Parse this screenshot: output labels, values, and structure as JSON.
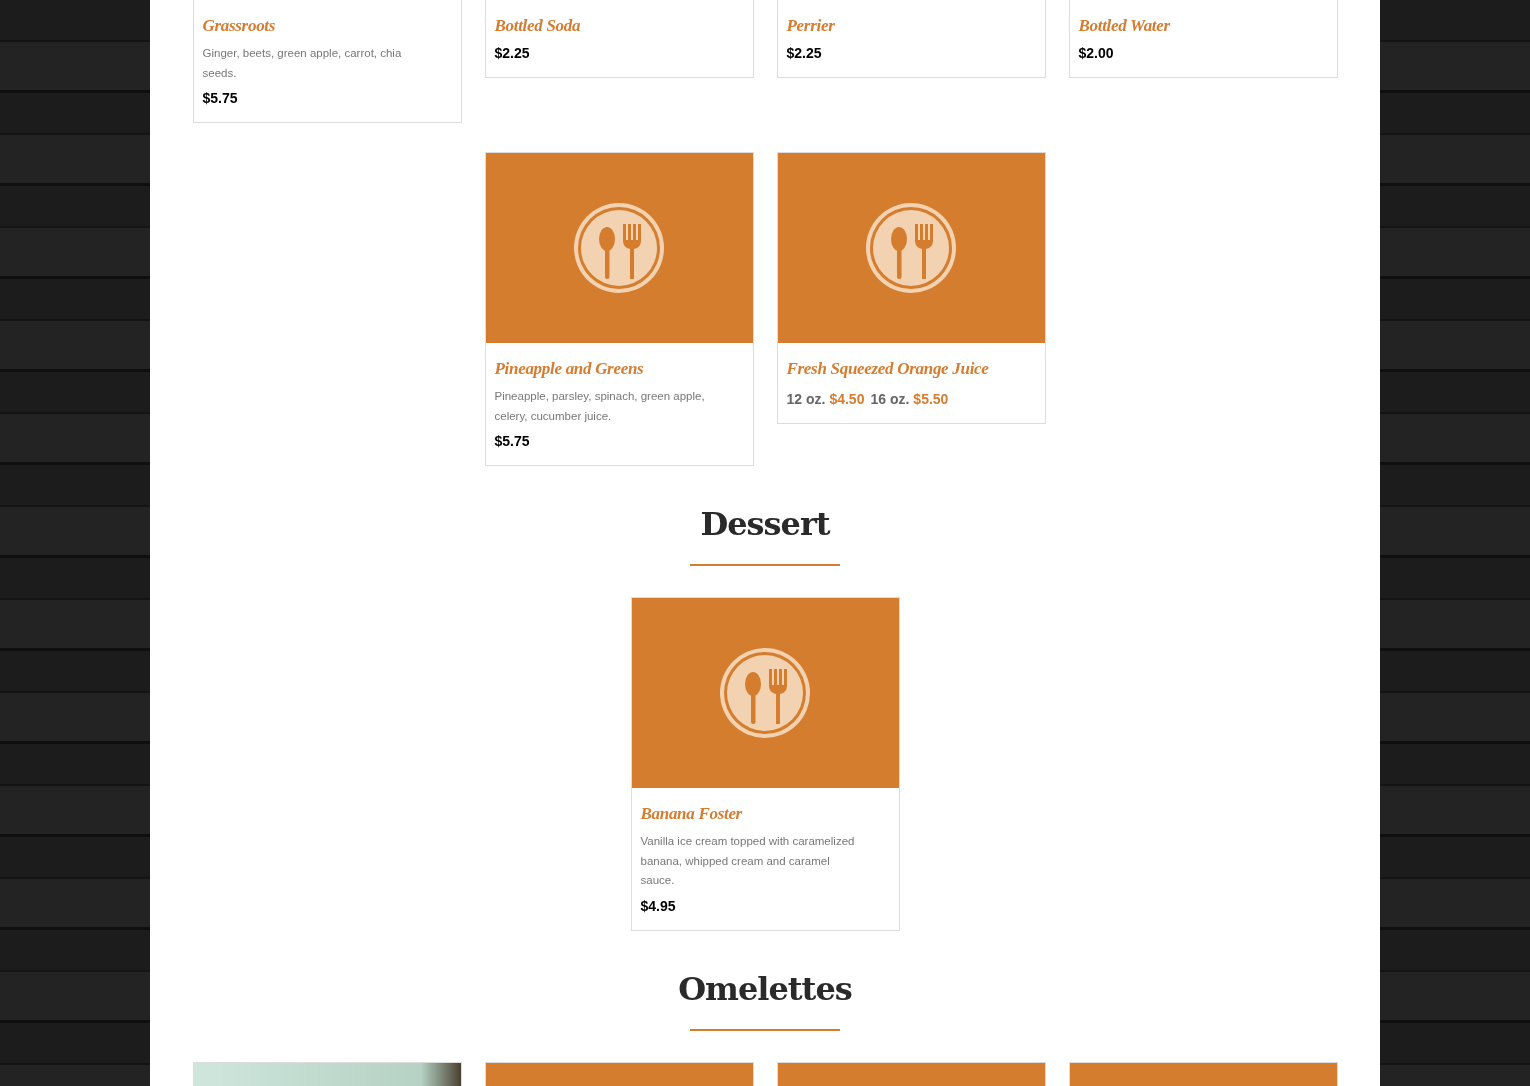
{
  "sections": [
    {
      "items": [
        {
          "title": "Grassroots",
          "description": "Ginger, beets, green apple, carrot, chia seeds.",
          "price": "$5.75"
        },
        {
          "title": "Bottled Soda",
          "price": "$2.25"
        },
        {
          "title": "Perrier",
          "price": "$2.25"
        },
        {
          "title": "Bottled Water",
          "price": "$2.00"
        },
        {
          "kind": "icon",
          "title": "Pineapple and Greens",
          "description": "Pineapple, parsley, spinach, green apple, celery, cucumber juice.",
          "price": "$5.75"
        },
        {
          "kind": "icon",
          "title": "Fresh Squeezed Orange Juice",
          "sizes": [
            {
              "size": "12 oz.",
              "price": "$4.50"
            },
            {
              "size": "16 oz.",
              "price": "$5.50"
            }
          ]
        }
      ]
    },
    {
      "heading": "Dessert",
      "items": [
        {
          "kind": "icon",
          "title": "Banana Foster",
          "description": "Vanilla ice cream topped with caramelized banana, whipped cream and caramel sauce.",
          "price": "$4.95"
        }
      ]
    },
    {
      "heading": "Omelettes",
      "items": [
        {
          "kind": "photo"
        },
        {
          "kind": "icon"
        },
        {
          "kind": "icon"
        },
        {
          "kind": "icon"
        }
      ]
    }
  ]
}
